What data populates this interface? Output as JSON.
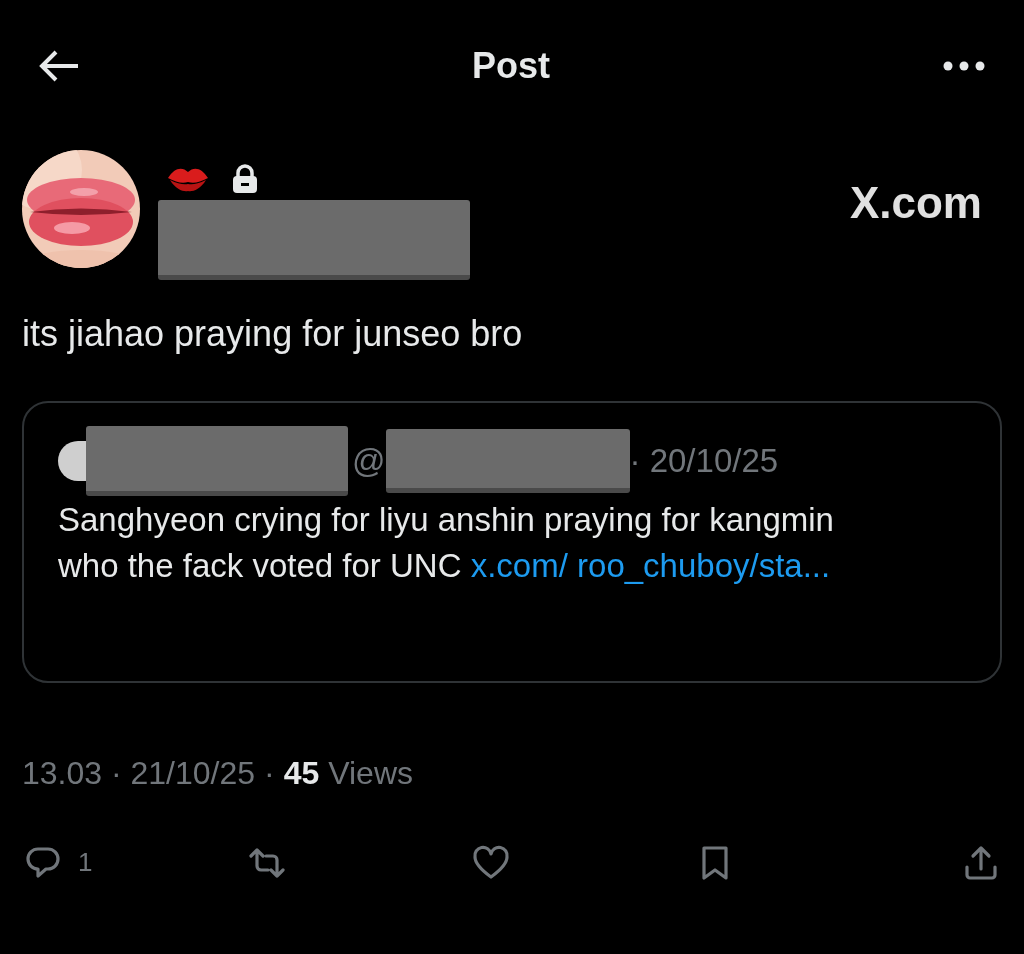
{
  "header": {
    "title": "Post"
  },
  "author": {
    "watermark": "X.com"
  },
  "post": {
    "text": "its jiahao praying for junseo bro"
  },
  "quote": {
    "at": "@",
    "date": "· 20/10/25",
    "text": "Sanghyeon crying for liyu anshin praying for kangmin who the fack voted for UNC",
    "link": "x.com/ roo_chuboy/sta..."
  },
  "meta": {
    "time": "13.03 · 21/10/25 ·",
    "views_count": "45",
    "views_label": "Views"
  },
  "actions": [
    {
      "kind": "reply",
      "count": "1"
    },
    {
      "kind": "repost"
    },
    {
      "kind": "like"
    },
    {
      "kind": "bookmark"
    },
    {
      "kind": "share"
    }
  ]
}
